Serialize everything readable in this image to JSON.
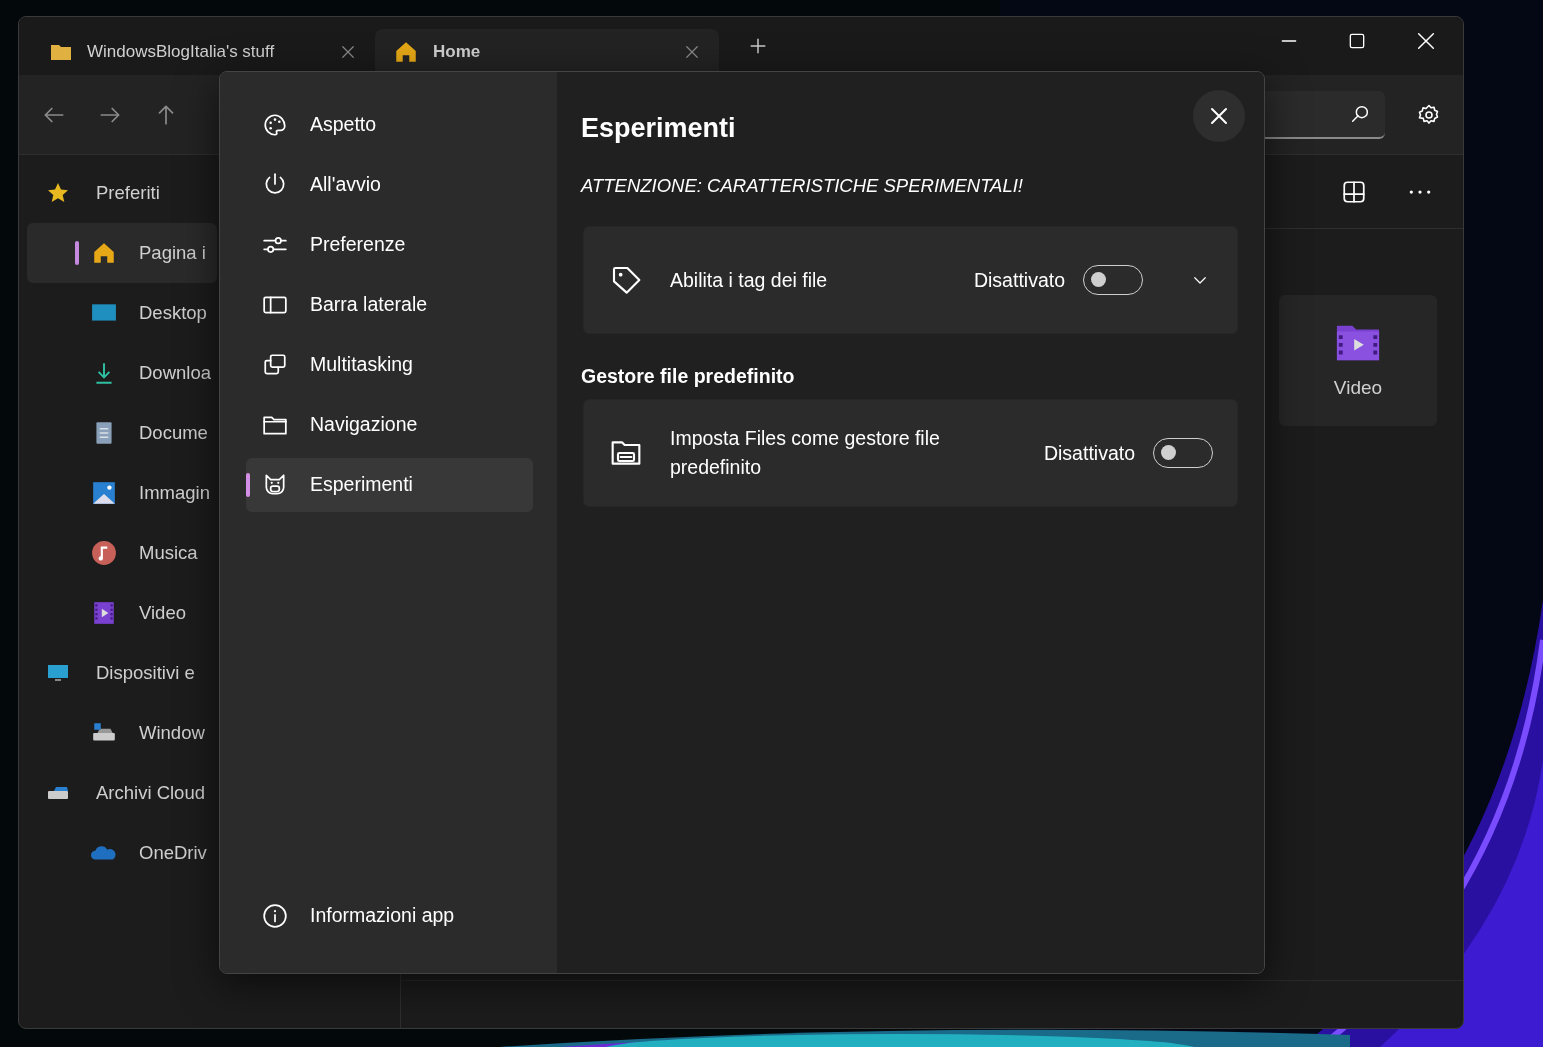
{
  "tabs": [
    {
      "label": "WindowsBlogItalia's stuff",
      "selected": false
    },
    {
      "label": "Home",
      "selected": true
    }
  ],
  "sidebar": {
    "items": [
      {
        "label": "Preferiti",
        "children": [
          {
            "label": "Pagina i",
            "selected": true
          },
          {
            "label": "Desktop",
            "selected": false
          },
          {
            "label": "Downloa",
            "selected": false
          },
          {
            "label": "Docume",
            "selected": false
          },
          {
            "label": "Immagin",
            "selected": false
          },
          {
            "label": "Musica",
            "selected": false
          },
          {
            "label": "Video",
            "selected": false
          }
        ]
      },
      {
        "label": "Dispositivi e",
        "children": [
          {
            "label": "Window",
            "selected": false
          }
        ]
      },
      {
        "label": "Archivi Cloud",
        "children": [
          {
            "label": "OneDriv",
            "selected": false
          }
        ]
      }
    ]
  },
  "content": {
    "tiles": [
      {
        "label": "Video"
      }
    ]
  },
  "settings": {
    "nav": [
      {
        "label": "Aspetto",
        "selected": false
      },
      {
        "label": "All'avvio",
        "selected": false
      },
      {
        "label": "Preferenze",
        "selected": false
      },
      {
        "label": "Barra laterale",
        "selected": false
      },
      {
        "label": "Multitasking",
        "selected": false
      },
      {
        "label": "Navigazione",
        "selected": false
      },
      {
        "label": "Esperimenti",
        "selected": true
      }
    ],
    "footer_item": "Informazioni app",
    "title": "Esperimenti",
    "warning": "ATTENZIONE: CARATTERISTICHE SPERIMENTALI!",
    "groups": [
      {
        "cards": [
          {
            "label": "Abilita i tag dei file",
            "state": "Disattivato",
            "on": false,
            "expandable": true
          }
        ]
      },
      {
        "heading": "Gestore file predefinito",
        "cards": [
          {
            "label": "Imposta Files come gestore file predefinito",
            "state": "Disattivato",
            "on": false,
            "expandable": false
          }
        ]
      }
    ]
  }
}
